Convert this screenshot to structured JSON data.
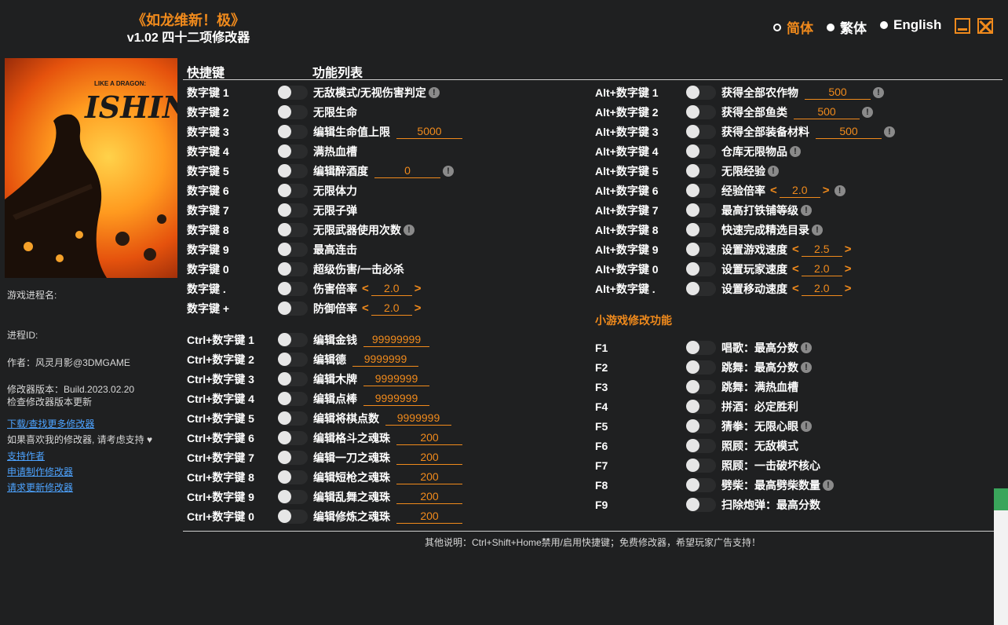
{
  "app": {
    "title": "《如龙维新！极》",
    "subtitle": "v1.02 四十二项修改器"
  },
  "languages": [
    {
      "label": "简体",
      "active": true
    },
    {
      "label": "繁体",
      "active": false
    },
    {
      "label": "English",
      "active": false
    }
  ],
  "cover": {
    "logo_small": "LIKE A DRAGON:",
    "logo_text": "ISHIN!"
  },
  "sidebar": {
    "process_name_label": "游戏进程名:",
    "process_id_label": "进程ID:",
    "author": "作者：风灵月影@3DMGAME",
    "version": "修改器版本：Build.2023.02.20",
    "check_update": "检查修改器版本更新",
    "download_more": "下载/查找更多修改器",
    "support_text": "如果喜欢我的修改器, 请考虑支持",
    "support_author": "支持作者",
    "request_make": "申请制作修改器",
    "request_update": "请求更新修改器"
  },
  "headers": {
    "hotkey": "快捷键",
    "functions": "功能列表"
  },
  "left_rows": [
    {
      "key": "数字键 1",
      "label": "无敌模式/无视伤害判定",
      "info": true
    },
    {
      "key": "数字键 2",
      "label": "无限生命"
    },
    {
      "key": "数字键 3",
      "label": "编辑生命值上限",
      "value": "5000"
    },
    {
      "key": "数字键 4",
      "label": "满热血槽"
    },
    {
      "key": "数字键 5",
      "label": "编辑醉酒度",
      "value": "0",
      "info": true
    },
    {
      "key": "数字键 6",
      "label": "无限体力"
    },
    {
      "key": "数字键 7",
      "label": "无限子弹"
    },
    {
      "key": "数字键 8",
      "label": "无限武器使用次数",
      "info": true
    },
    {
      "key": "数字键 9",
      "label": "最高连击"
    },
    {
      "key": "数字键 0",
      "label": "超级伤害/一击必杀"
    },
    {
      "key": "数字键 .",
      "label": "伤害倍率",
      "stepper": "2.0"
    },
    {
      "key": "数字键 +",
      "label": "防御倍率",
      "stepper": "2.0"
    },
    {
      "key": "Ctrl+数字键 1",
      "label": "编辑金钱",
      "value": "99999999"
    },
    {
      "key": "Ctrl+数字键 2",
      "label": "编辑德",
      "value": "9999999"
    },
    {
      "key": "Ctrl+数字键 3",
      "label": "编辑木牌",
      "value": "9999999"
    },
    {
      "key": "Ctrl+数字键 4",
      "label": "编辑点棒",
      "value": "9999999"
    },
    {
      "key": "Ctrl+数字键 5",
      "label": "编辑将棋点数",
      "value": "9999999"
    },
    {
      "key": "Ctrl+数字键 6",
      "label": "编辑格斗之魂珠",
      "value": "200"
    },
    {
      "key": "Ctrl+数字键 7",
      "label": "编辑一刀之魂珠",
      "value": "200"
    },
    {
      "key": "Ctrl+数字键 8",
      "label": "编辑短枪之魂珠",
      "value": "200"
    },
    {
      "key": "Ctrl+数字键 9",
      "label": "编辑乱舞之魂珠",
      "value": "200"
    },
    {
      "key": "Ctrl+数字键 0",
      "label": "编辑修炼之魂珠",
      "value": "200"
    }
  ],
  "right_rows": [
    {
      "key": "Alt+数字键 1",
      "label": "获得全部农作物",
      "value": "500",
      "info": true
    },
    {
      "key": "Alt+数字键 2",
      "label": "获得全部鱼类",
      "value": "500",
      "info": true
    },
    {
      "key": "Alt+数字键 3",
      "label": "获得全部装备材料",
      "value": "500",
      "info": true
    },
    {
      "key": "Alt+数字键 4",
      "label": "仓库无限物品",
      "info": true
    },
    {
      "key": "Alt+数字键 5",
      "label": "无限经验",
      "info": true
    },
    {
      "key": "Alt+数字键 6",
      "label": "经验倍率",
      "stepper": "2.0",
      "info": true
    },
    {
      "key": "Alt+数字键 7",
      "label": "最高打铁铺等级",
      "info": true
    },
    {
      "key": "Alt+数字键 8",
      "label": "快速完成精选目录",
      "info": true
    },
    {
      "key": "Alt+数字键 9",
      "label": "设置游戏速度",
      "stepper": "2.5"
    },
    {
      "key": "Alt+数字键 0",
      "label": "设置玩家速度",
      "stepper": "2.0"
    },
    {
      "key": "Alt+数字键 .",
      "label": "设置移动速度",
      "stepper": "2.0"
    }
  ],
  "minigame_title": "小游戏修改功能",
  "minigame_rows": [
    {
      "key": "F1",
      "label": "唱歌：最高分数",
      "info": true
    },
    {
      "key": "F2",
      "label": "跳舞：最高分数",
      "info": true
    },
    {
      "key": "F3",
      "label": "跳舞：满热血槽"
    },
    {
      "key": "F4",
      "label": "拼酒：必定胜利"
    },
    {
      "key": "F5",
      "label": "猜拳：无限心眼",
      "info": true
    },
    {
      "key": "F6",
      "label": "照顾：无敌模式"
    },
    {
      "key": "F7",
      "label": "照顾：一击破坏核心"
    },
    {
      "key": "F8",
      "label": "劈柴：最高劈柴数量",
      "info": true
    },
    {
      "key": "F9",
      "label": "扫除炮弹：最高分数"
    }
  ],
  "footer": "其他说明：Ctrl+Shift+Home禁用/启用快捷键；免费修改器，希望玩家广告支持！",
  "colors": {
    "accent": "#f08a1c",
    "background": "#1f2021",
    "link": "#4da3ff"
  }
}
